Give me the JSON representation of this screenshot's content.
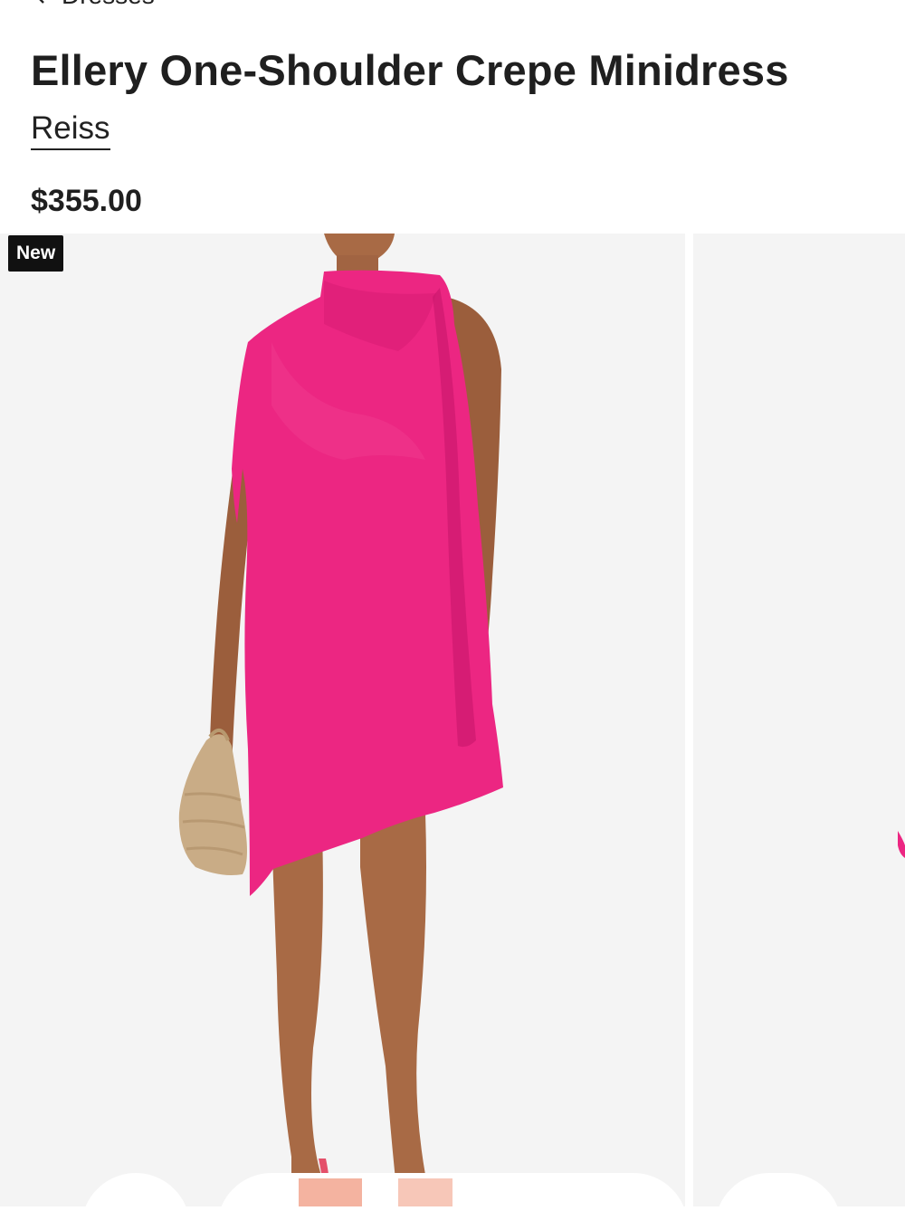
{
  "breadcrumb": {
    "label": "Dresses"
  },
  "product": {
    "title": "Ellery One-Shoulder Crepe Minidress",
    "brand": "Reiss",
    "price": "$355.00",
    "badge": "New"
  },
  "colors": {
    "dress": "#ec2682",
    "badge_bg": "#111111",
    "gallery_bg": "#f4f4f4"
  },
  "icons": {
    "back": "chevron-left-icon"
  },
  "gallery": {
    "image": "product-photo",
    "next_image": "product-photo-next"
  }
}
